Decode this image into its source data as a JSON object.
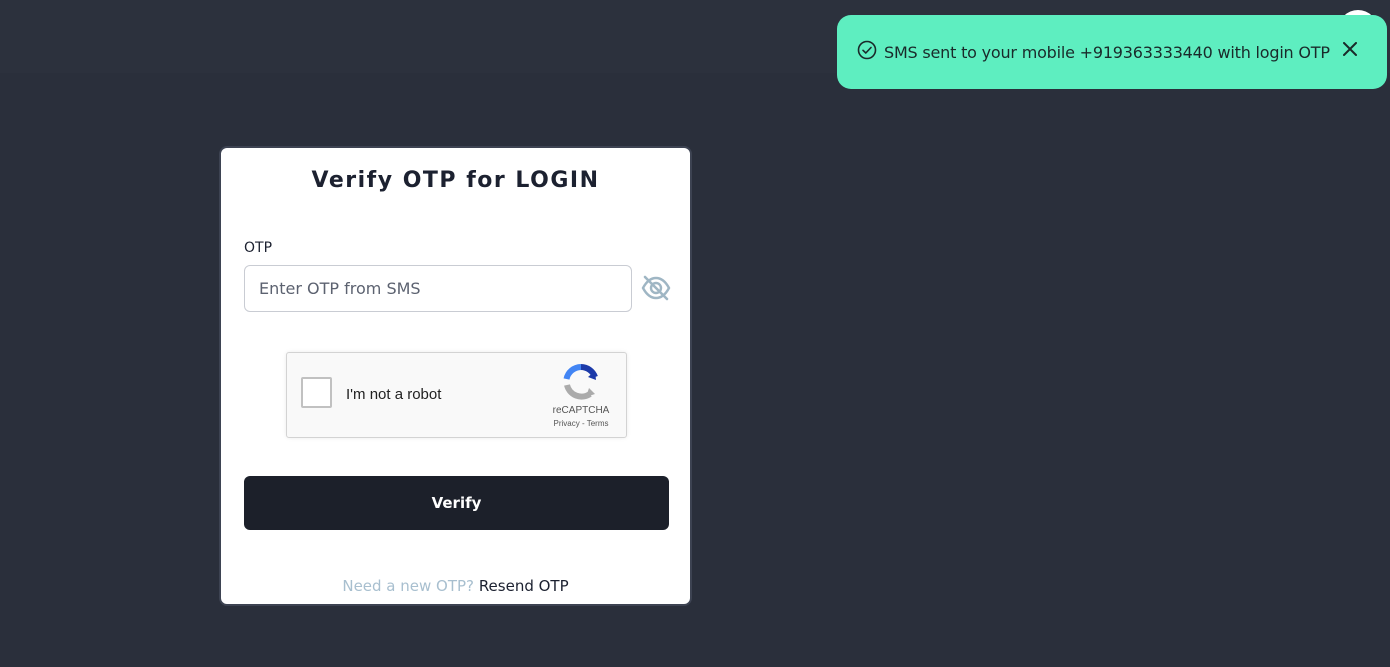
{
  "toast": {
    "message": "SMS sent to your mobile +919363333440 with login OTP",
    "icon": "check-circle-icon",
    "close_icon": "close-icon",
    "color": "#5eeec0"
  },
  "card": {
    "title": "Verify OTP for LOGIN",
    "otp_label": "OTP",
    "otp_placeholder": "Enter OTP from SMS",
    "otp_value": "",
    "recaptcha": {
      "label": "I'm not a robot",
      "brand": "reCAPTCHA",
      "links": "Privacy - Terms"
    },
    "verify_label": "Verify",
    "resend_question": "Need a new OTP?",
    "resend_link": "Resend OTP"
  }
}
